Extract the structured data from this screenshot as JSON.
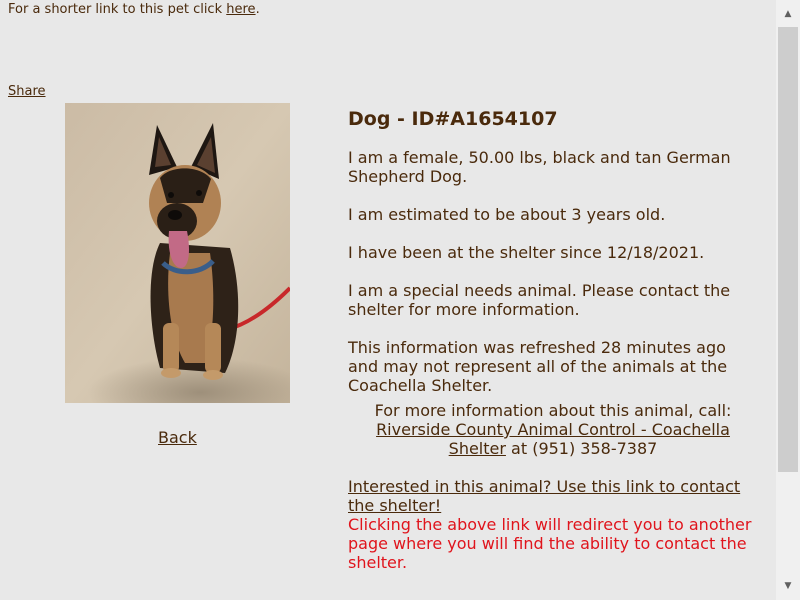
{
  "top": {
    "shorter_link_text": "For a shorter link to this pet click",
    "here_link": "here",
    "period": ".",
    "share_link": "Share"
  },
  "photo": {
    "alt": "black and tan German Shepherd Dog sitting on sand"
  },
  "back_link": "Back",
  "info": {
    "title": "Dog - ID#A1654107",
    "description": "I am a female, 50.00 lbs, black and tan German Shepherd Dog.",
    "age": "I am estimated to be about 3 years old.",
    "since": "I have been at the shelter since 12/18/2021.",
    "special_needs": "I am a special needs animal. Please contact the shelter for more information.",
    "refresh_note": "This information was refreshed 28 minutes ago and may not represent all of the animals at the Coachella Shelter.",
    "contact_intro": "For more information about this animal, call:",
    "shelter_link": "Riverside County Animal Control - Coachella Shelter",
    "phone": "at (951) 358-7387",
    "interested_link": "Interested in this animal? Use this link to contact the shelter!",
    "redirect_note": "Clicking the above link will redirect you to another page where you will find the ability to contact the shelter."
  },
  "colors": {
    "text": "#4a2a0c",
    "background": "#e8e8e8",
    "warning": "#e0141c"
  }
}
